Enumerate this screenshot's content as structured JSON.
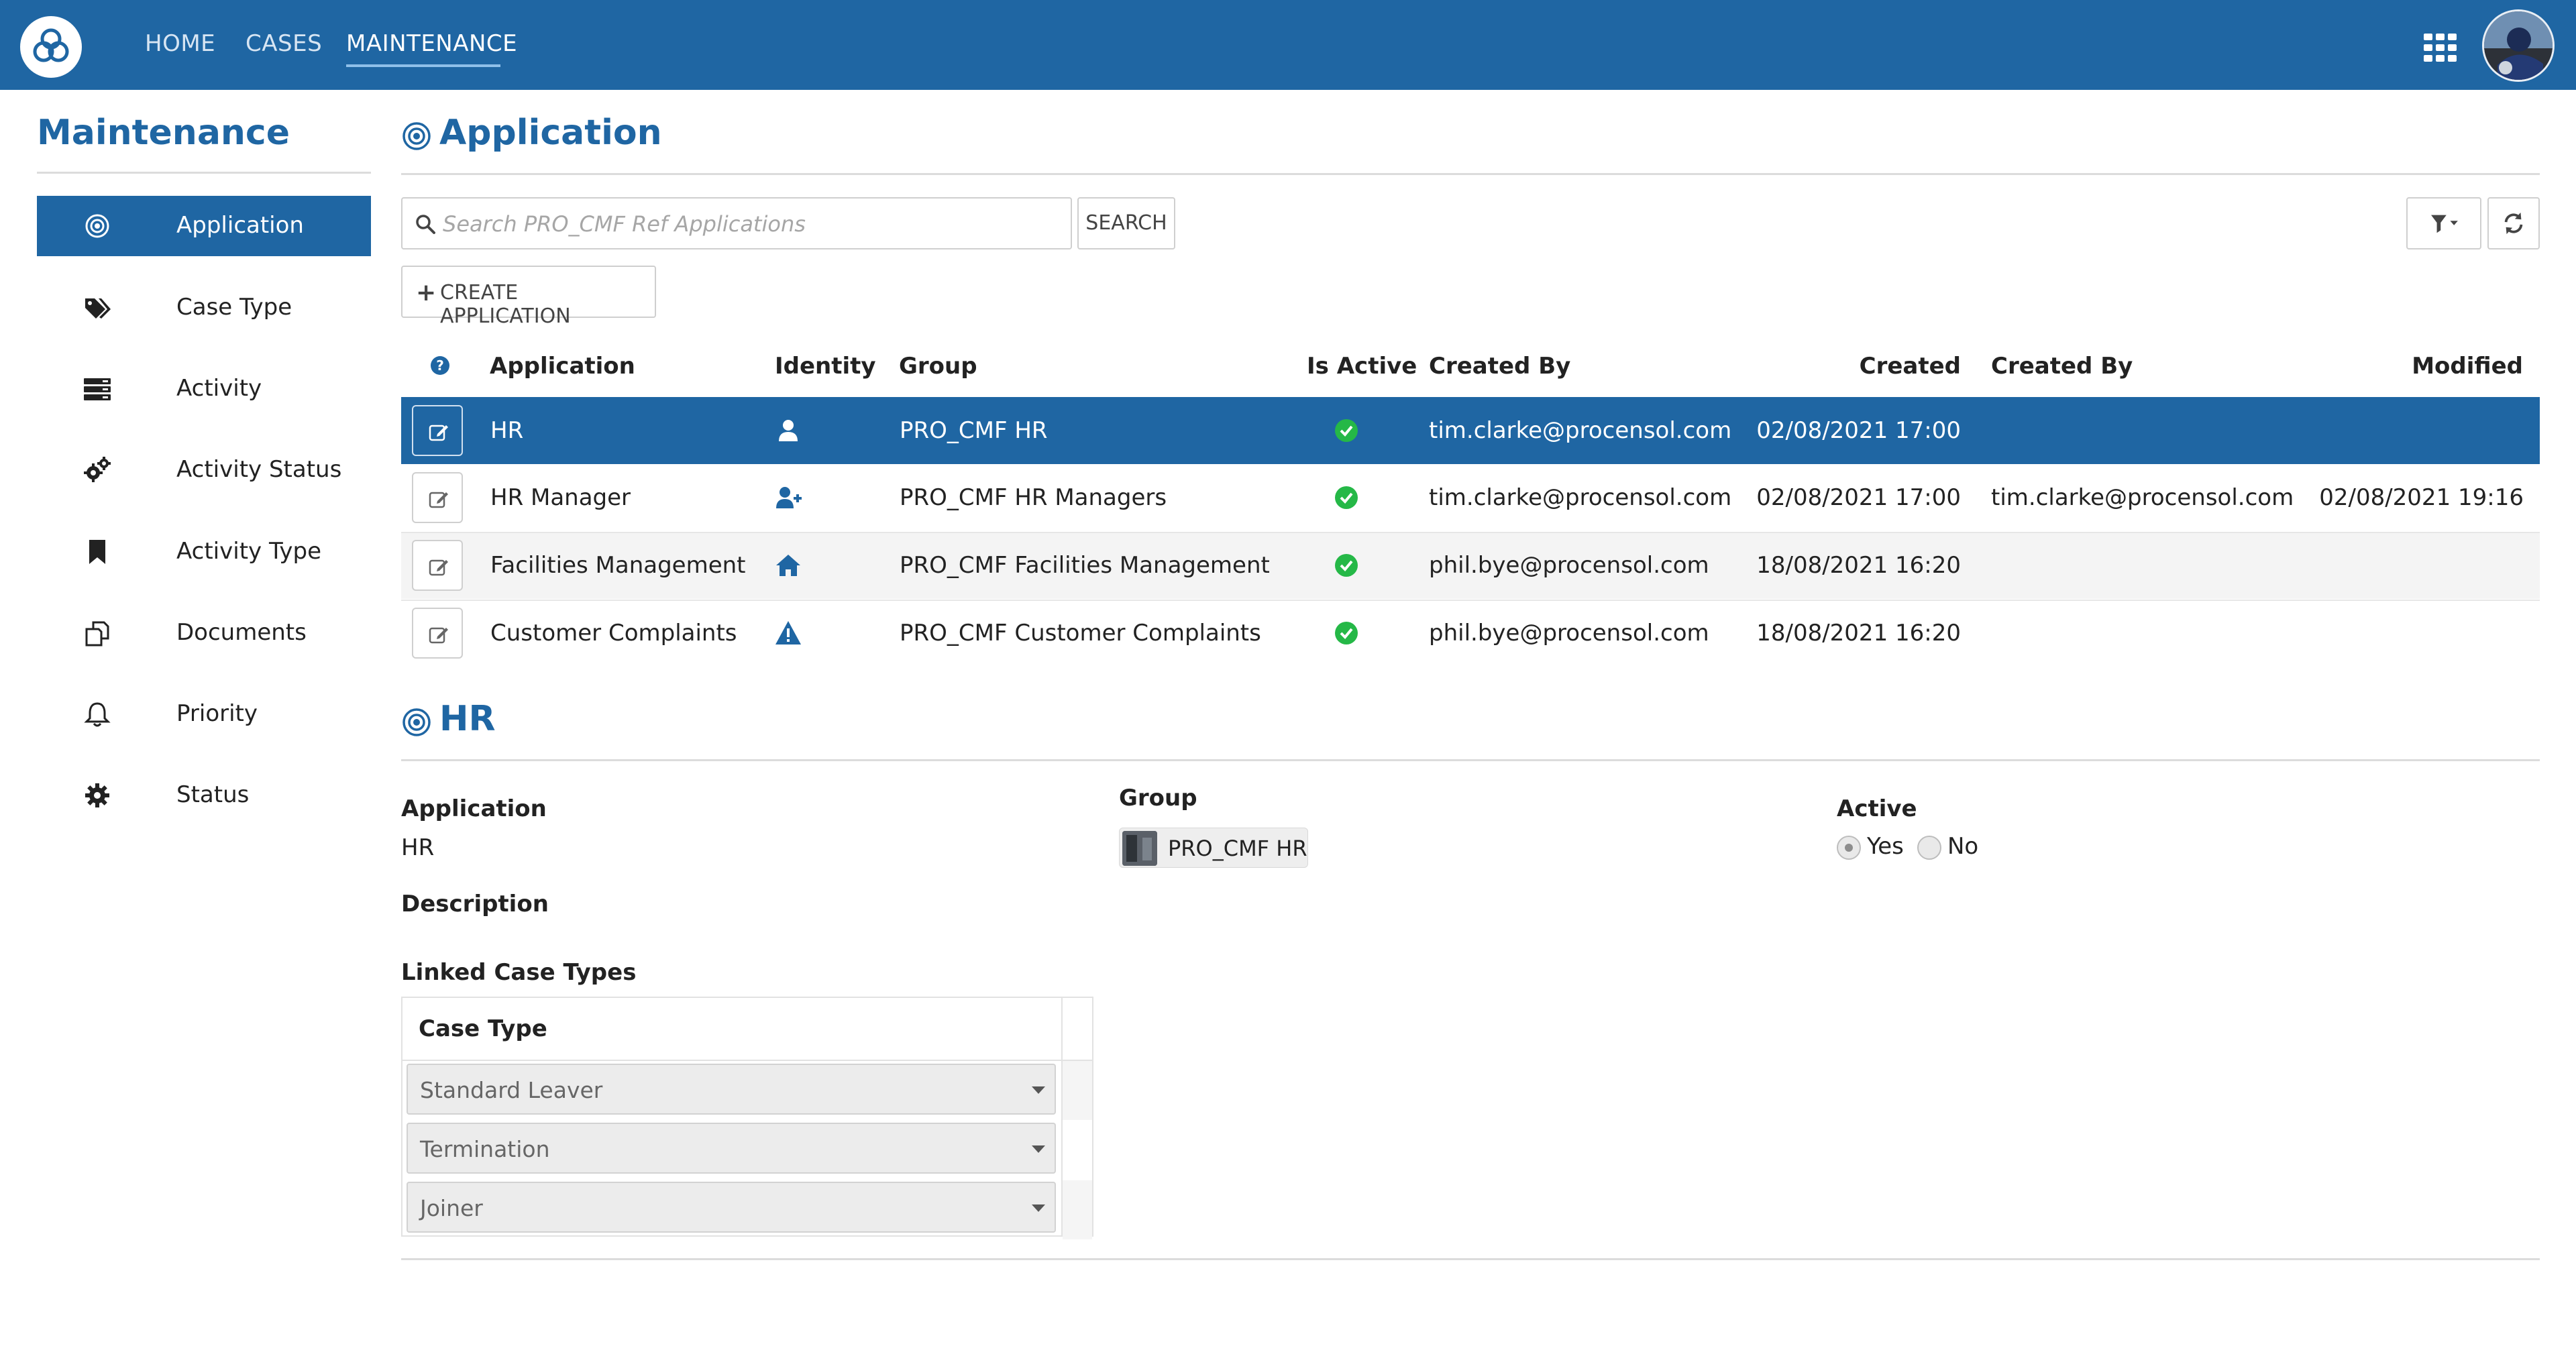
{
  "topbar": {
    "nav": [
      "HOME",
      "CASES",
      "MAINTENANCE"
    ],
    "active_nav": "MAINTENANCE",
    "color": "#1f66a3"
  },
  "sidebar": {
    "title": "Maintenance",
    "items": [
      {
        "label": "Application",
        "icon": "target-icon",
        "active": true
      },
      {
        "label": "Case Type",
        "icon": "tags-icon"
      },
      {
        "label": "Activity",
        "icon": "server-list-icon"
      },
      {
        "label": "Activity Status",
        "icon": "gears-icon"
      },
      {
        "label": "Activity Type",
        "icon": "bookmark-icon"
      },
      {
        "label": "Documents",
        "icon": "copy-documents-icon"
      },
      {
        "label": "Priority",
        "icon": "bell-icon"
      },
      {
        "label": "Status",
        "icon": "gear-icon"
      }
    ]
  },
  "main": {
    "title": "Application",
    "search": {
      "placeholder": "Search PRO_CMF Ref Applications",
      "button": "SEARCH"
    },
    "create_button": "CREATE APPLICATION",
    "columns": [
      "Application",
      "Identity",
      "Group",
      "Is Active",
      "Created By",
      "Created",
      "Created By",
      "Modified"
    ],
    "rows": [
      {
        "application": "HR",
        "identity_icon": "user-icon",
        "group": "PRO_CMF HR",
        "active": true,
        "created_by": "tim.clarke@procensol.com",
        "created": "02/08/2021 17:00",
        "modified_by": "",
        "modified": "",
        "selected": true
      },
      {
        "application": "HR Manager",
        "identity_icon": "user-plus-icon",
        "group": "PRO_CMF HR Managers",
        "active": true,
        "created_by": "tim.clarke@procensol.com",
        "created": "02/08/2021 17:00",
        "modified_by": "tim.clarke@procensol.com",
        "modified": "02/08/2021 19:16"
      },
      {
        "application": "Facilities Management",
        "identity_icon": "home-icon",
        "group": "PRO_CMF Facilities Management",
        "active": true,
        "created_by": "phil.bye@procensol.com",
        "created": "18/08/2021 16:20",
        "modified_by": "",
        "modified": ""
      },
      {
        "application": "Customer Complaints",
        "identity_icon": "warning-icon",
        "group": "PRO_CMF Customer Complaints",
        "active": true,
        "created_by": "phil.bye@procensol.com",
        "created": "18/08/2021 16:20",
        "modified_by": "",
        "modified": ""
      }
    ]
  },
  "detail": {
    "title": "HR",
    "application_label": "Application",
    "application_value": "HR",
    "group_label": "Group",
    "group_value": "PRO_CMF HR",
    "active_label": "Active",
    "active_options": [
      "Yes",
      "No"
    ],
    "active_value": "Yes",
    "description_label": "Description",
    "linked_label": "Linked Case Types",
    "case_type_header": "Case Type",
    "case_types": [
      "Standard Leaver",
      "Termination",
      "Joiner"
    ]
  }
}
